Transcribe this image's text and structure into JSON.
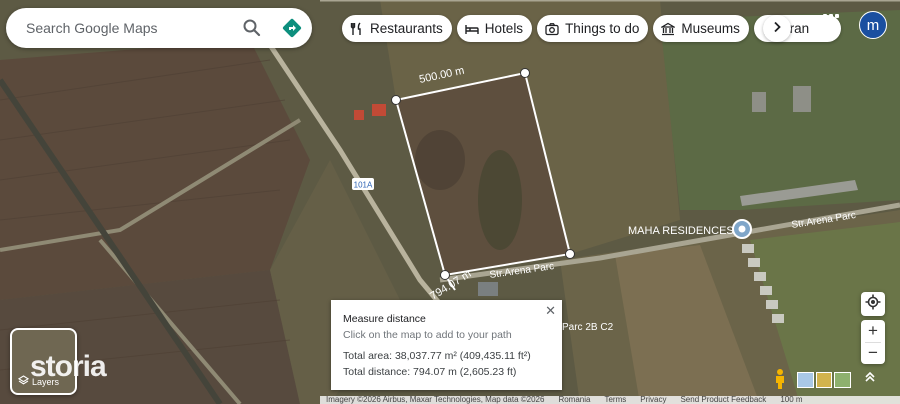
{
  "search": {
    "placeholder": "Search Google Maps"
  },
  "chips": [
    {
      "label": "Restaurants",
      "icon": "fork-knife-icon"
    },
    {
      "label": "Hotels",
      "icon": "bed-icon"
    },
    {
      "label": "Things to do",
      "icon": "camera-icon"
    },
    {
      "label": "Museums",
      "icon": "museum-icon"
    },
    {
      "label": "Tran",
      "icon": "train-icon"
    }
  ],
  "account": {
    "initial": "m"
  },
  "map": {
    "road_badge": "101A",
    "segment_labels": {
      "top": "500.00 m",
      "left": "794.07 m"
    },
    "street_labels": {
      "main": "Str.Arena Parc",
      "east": "Str.Arena Parc"
    },
    "place_labels": {
      "residences": "MAHA RESIDENCES",
      "parc": "Parc 2B C2"
    }
  },
  "measure_panel": {
    "title": "Measure distance",
    "subtitle": "Click on the map to add to your path",
    "total_area": "Total area: 38,037.77 m² (409,435.11 ft²)",
    "total_distance": "Total distance: 794.07 m (2,605.23 ft)"
  },
  "layers": {
    "label": "Layers"
  },
  "watermark": "storia",
  "footer": {
    "imagery": "Imagery ©2026 Airbus, Maxar Technologies, Map data ©2026",
    "country": "Romania",
    "terms": "Terms",
    "privacy": "Privacy",
    "feedback": "Send Product Feedback",
    "scale": "100 m"
  },
  "colors": {
    "accent": "#1a73e8",
    "directions": "#0d8f7e",
    "avatar": "#1a4fa0"
  }
}
